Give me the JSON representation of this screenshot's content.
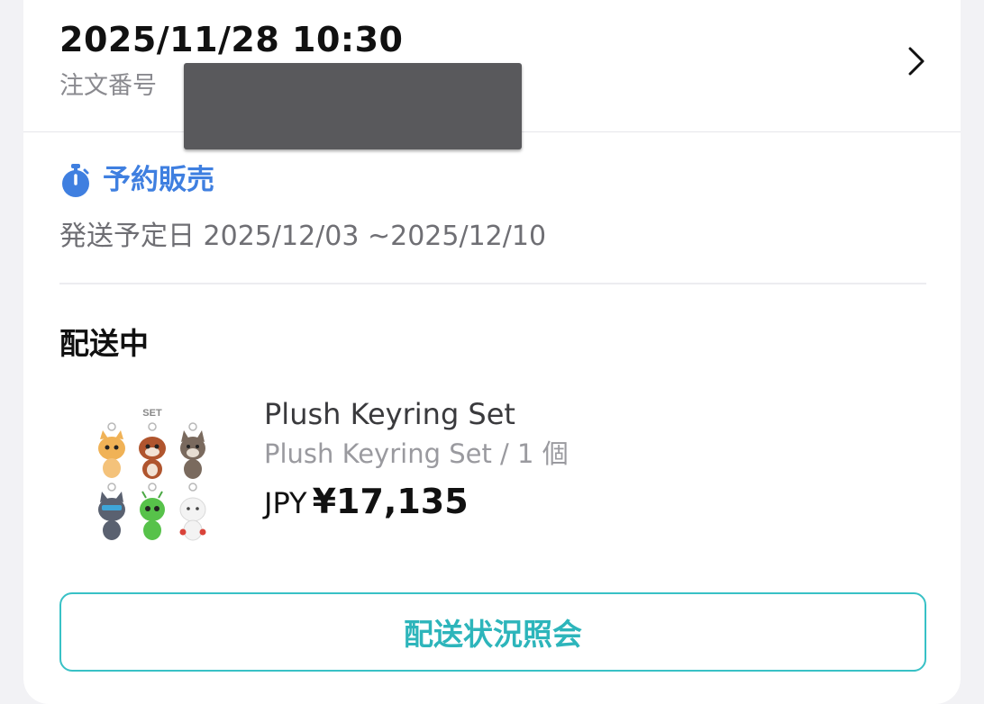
{
  "order": {
    "datetime": "2025/11/28 10:30",
    "number_label": "注文番号"
  },
  "preorder": {
    "label": "予約販売",
    "icon": "timer-icon",
    "color": "#3f7fe0"
  },
  "shipping": {
    "scheduled_date": "発送予定日 2025/12/03 ~2025/12/10",
    "status": "配送中"
  },
  "product": {
    "image_text": "SET",
    "title": "Plush Keyring Set",
    "subtitle": "Plush Keyring Set / 1 個",
    "currency": "JPY",
    "price": "¥17,135"
  },
  "actions": {
    "track_label": "配送状況照会",
    "accent": "#38c1c6"
  }
}
